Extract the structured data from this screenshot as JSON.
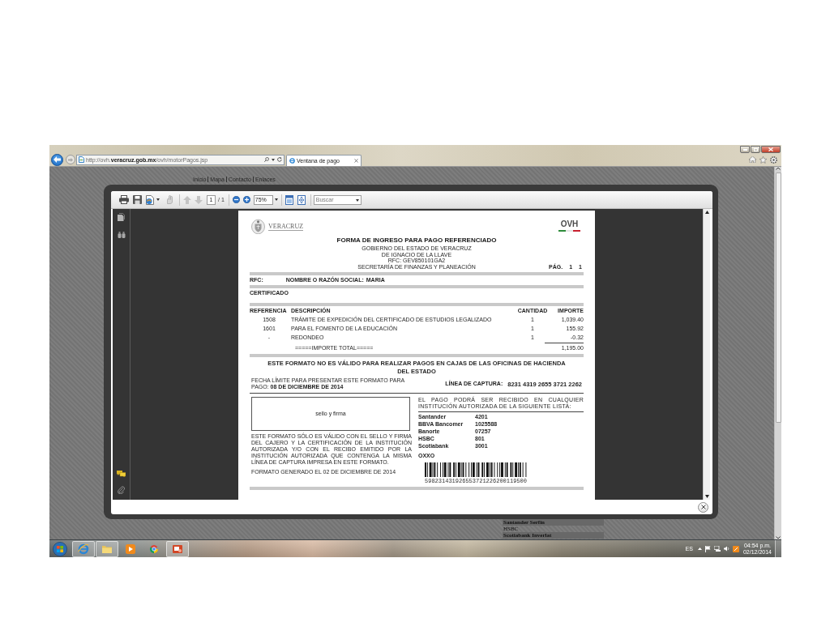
{
  "browser": {
    "address": "http://ovh.**veracruz.gob.mx**/ovh/motorPagos.jsp",
    "tabs": [
      {
        "label": "Ventana de pago",
        "selected": true
      }
    ]
  },
  "web_page": {
    "nav_links": [
      "Inicio",
      "Mapa",
      "Contacto",
      "Enlaces"
    ],
    "bank_rows": [
      {
        "label": "Santander Serfin",
        "highlighted": true
      },
      {
        "label": "HSBC",
        "highlighted": false
      },
      {
        "label": "Scotiabank Inverlat",
        "highlighted": true
      }
    ]
  },
  "pdf_viewer": {
    "toolbar": {
      "file_buttons": [
        {
          "kind": "print",
          "disabled": false
        },
        {
          "kind": "save",
          "disabled": false
        },
        {
          "kind": "export",
          "disabled": false
        },
        {
          "kind": "hand",
          "disabled": true
        }
      ],
      "page_buttons": [
        {
          "kind": "up",
          "disabled": true
        },
        {
          "kind": "down",
          "disabled": true
        }
      ],
      "page": "1",
      "page_total": "/ 1",
      "zoom_buttons": [
        {
          "kind": "zoom-out",
          "disabled": false
        },
        {
          "kind": "zoom-in",
          "disabled": false
        }
      ],
      "zoom": "75%",
      "view_buttons": [
        {
          "kind": "fit-page",
          "disabled": false
        },
        {
          "kind": "fit-width",
          "disabled": false
        }
      ],
      "search": {
        "placeholder": "Buscar"
      }
    },
    "document": {
      "logo_text": "VERACRUZ",
      "badge": "OVH",
      "title": "FORMA DE INGRESO PARA PAGO REFERENCIADO",
      "issuer_lines": [
        "GOBIERNO DEL ESTADO DE VERACRUZ",
        "DE IGNACIO DE LA LLAVE",
        "RFC: GEV850101GA2",
        "SECRETARÍA DE FINANZAS Y PLANEACIÓN"
      ],
      "page_label": "PÁG.",
      "page_number": "1",
      "page_count": "1",
      "rfc_label": "RFC:",
      "name_label": "NOMBRE O RAZÓN SOCIAL:",
      "name": "MARIA",
      "concept": "CERTIFICADO",
      "columns": [
        "REFERENCIA",
        "DESCRIPCIÓN",
        "CANTIDAD",
        "IMPORTE"
      ],
      "rows": [
        {
          "reference": "1508",
          "description": "TRÁMITE DE EXPEDICIÓN DEL CERTIFICADO DE ESTUDIOS LEGALIZADO",
          "quantity": "1",
          "amount": "1,039.40"
        },
        {
          "reference": "1601",
          "description": "PARA EL FOMENTO DE LA EDUCACIÓN",
          "quantity": "1",
          "amount": "155.92"
        },
        {
          "reference": "-",
          "description": "REDONDEO",
          "quantity": "1",
          "amount": "-0.32"
        }
      ],
      "total_label": "=====IMPORTE TOTAL=====",
      "total": "1,195.00",
      "warning": "ESTE FORMATO NO ES VÁLIDO PARA REALIZAR PAGOS EN CAJAS DE LAS OFICINAS DE HACIENDA DEL ESTADO",
      "deadline": "FECHA LÍMITE PARA PRESENTAR ESTE FORMATO PARA PAGO: **08 DE DICIEMBRE DE 2014**",
      "capture_label": "LÍNEA DE CAPTURA:",
      "capture_line": "8231 4319 2655 3721 2262",
      "stamp_label": "sello y firma",
      "validity_note": "ESTE FORMATO SÓLO ES VÁLIDO CON EL SELLO Y FIRMA DEL CAJERO Y LA CERTIFICACIÓN DE LA INSTITUCIÓN AUTORIZADA Y/O CON EL RECIBO EMITIDO POR LA INSTITUCIÓN AUTORIZADA QUE CONTENGA LA MISMA LÍNEA DE CAPTURA IMPRESA EN ESTE FORMATO.",
      "generated": "FORMATO GENERADO EL 02 DE DICIEMBRE DE 2014",
      "institutions_note": "EL PAGO PODRÁ SER RECIBIDO EN CUALQUIER INSTITUCIÓN AUTORIZADA DE LA SIGUIENTE LISTA:",
      "institutions": [
        {
          "name": "Santander",
          "code": "4201"
        },
        {
          "name": "BBVA Bancomer",
          "code": "1025588"
        },
        {
          "name": "Banorte",
          "code": "07257"
        },
        {
          "name": "HSBC",
          "code": "801"
        },
        {
          "name": "Scotiabank",
          "code": "3001"
        }
      ],
      "store": "OXXO",
      "barcode_text": "598231431926553721226200119500"
    }
  },
  "taskbar": {
    "apps": [
      {
        "kind": "ie",
        "running": true
      },
      {
        "kind": "folder",
        "running": true
      },
      {
        "kind": "media",
        "running": false
      },
      {
        "kind": "chrome",
        "running": false
      },
      {
        "kind": "slides",
        "running": true
      }
    ],
    "language": "ES",
    "time": "04:54 p.m.",
    "date": "02/12/2014"
  }
}
